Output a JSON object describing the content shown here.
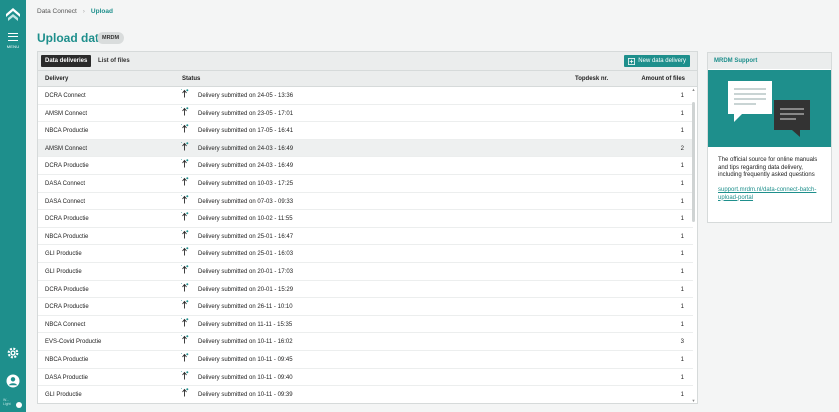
{
  "rail": {
    "menu_label": "MENU",
    "bottom_line1": "W...",
    "bottom_line2": "Light"
  },
  "breadcrumb": {
    "items": [
      "Data Connect",
      "Upload"
    ]
  },
  "page": {
    "title": "Upload data",
    "badge": "MRDM"
  },
  "toolbar": {
    "tabs": [
      "Data deliveries",
      "List of files"
    ],
    "new_button": "New data delivery"
  },
  "table": {
    "headers": [
      "Delivery",
      "Status",
      "Topdesk nr.",
      "Amount of files"
    ],
    "rows": [
      {
        "delivery": "DCRA Connect",
        "status": "Delivery submitted on 24-05 - 13:36",
        "topdesk": "",
        "files": "1"
      },
      {
        "delivery": "AMSM Connect",
        "status": "Delivery submitted on 23-05 - 17:01",
        "topdesk": "",
        "files": "1"
      },
      {
        "delivery": "NBCA Productie",
        "status": "Delivery submitted on 17-05 - 16:41",
        "topdesk": "",
        "files": "1"
      },
      {
        "delivery": "AMSM Connect",
        "status": "Delivery submitted on 24-03 - 16:49",
        "topdesk": "",
        "files": "2"
      },
      {
        "delivery": "DCRA Productie",
        "status": "Delivery submitted on 24-03 - 16:49",
        "topdesk": "",
        "files": "1"
      },
      {
        "delivery": "DASA Connect",
        "status": "Delivery submitted on 10-03 - 17:25",
        "topdesk": "",
        "files": "1"
      },
      {
        "delivery": "DASA Connect",
        "status": "Delivery submitted on 07-03 - 09:33",
        "topdesk": "",
        "files": "1"
      },
      {
        "delivery": "DCRA Productie",
        "status": "Delivery submitted on 10-02 - 11:55",
        "topdesk": "",
        "files": "1"
      },
      {
        "delivery": "NBCA Productie",
        "status": "Delivery submitted on 25-01 - 16:47",
        "topdesk": "",
        "files": "1"
      },
      {
        "delivery": "GLI Productie",
        "status": "Delivery submitted on 25-01 - 16:03",
        "topdesk": "",
        "files": "1"
      },
      {
        "delivery": "GLI Productie",
        "status": "Delivery submitted on 20-01 - 17:03",
        "topdesk": "",
        "files": "1"
      },
      {
        "delivery": "DCRA Productie",
        "status": "Delivery submitted on 20-01 - 15:29",
        "topdesk": "",
        "files": "1"
      },
      {
        "delivery": "DCRA Productie",
        "status": "Delivery submitted on 26-11 - 10:10",
        "topdesk": "",
        "files": "1"
      },
      {
        "delivery": "NBCA Connect",
        "status": "Delivery submitted on 11-11 - 15:35",
        "topdesk": "",
        "files": "1"
      },
      {
        "delivery": "EVS-Covid Productie",
        "status": "Delivery submitted on 10-11 - 16:02",
        "topdesk": "",
        "files": "3"
      },
      {
        "delivery": "NBCA Productie",
        "status": "Delivery submitted on 10-11 - 09:45",
        "topdesk": "",
        "files": "1"
      },
      {
        "delivery": "DASA Productie",
        "status": "Delivery submitted on 10-11 - 09:40",
        "topdesk": "",
        "files": "1"
      },
      {
        "delivery": "GLI Productie",
        "status": "Delivery submitted on 10-11 - 09:39",
        "topdesk": "",
        "files": "1"
      }
    ],
    "highlighted_row": 3
  },
  "support": {
    "title": "MRDM Support",
    "text": "The official source for online manuals and tips regarding data delivery, including frequently asked questions",
    "link": "support.mrdm.nl/data-connect-batch-upload-portal"
  },
  "colors": {
    "accent": "#1e8f8c",
    "header_bg": "#ebeded",
    "highlight": "#eef0f0"
  },
  "icons": {
    "logo": "mrdm-logo-icon",
    "menu": "hamburger-menu-icon",
    "settings": "gear-icon",
    "user": "user-icon",
    "status": "upload-arrow-icon",
    "new_delivery": "new-delivery-icon",
    "support": "chat-bubbles-icon"
  }
}
